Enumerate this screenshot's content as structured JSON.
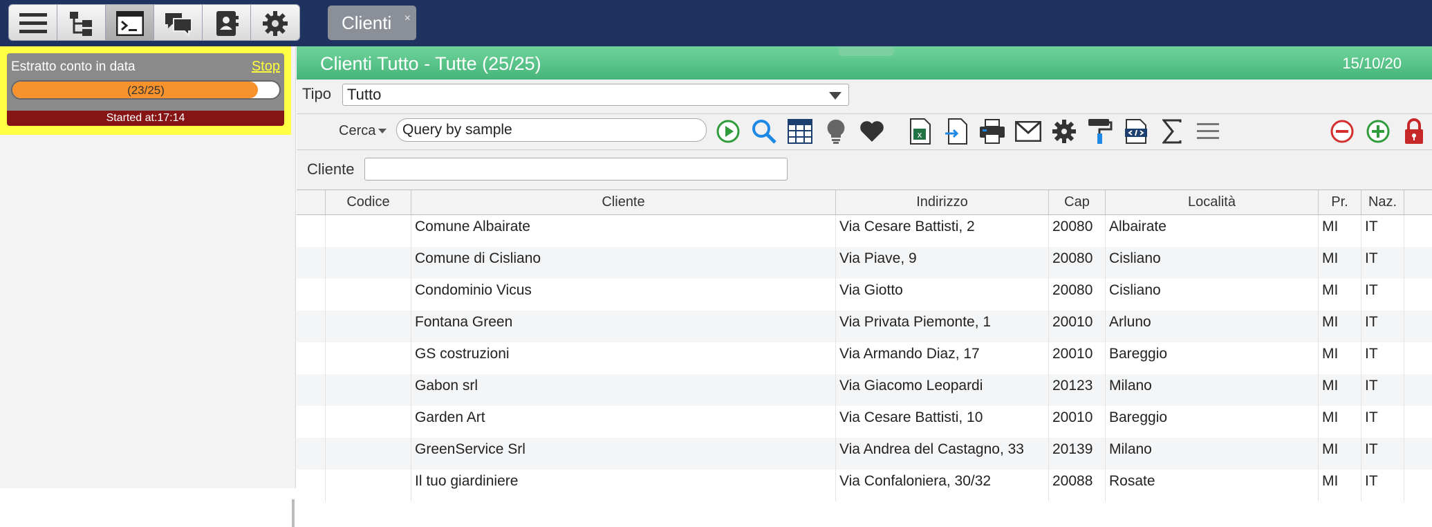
{
  "topbar": {
    "buttons": [
      {
        "icon": "menu-icon"
      },
      {
        "icon": "tree-icon"
      },
      {
        "icon": "terminal-icon"
      },
      {
        "icon": "chat-icon"
      },
      {
        "icon": "contacts-icon"
      },
      {
        "icon": "gear-icon"
      }
    ],
    "tab": {
      "label": "Clienti",
      "close": "×"
    }
  },
  "job": {
    "title": "Estratto conto in data",
    "stop_label": "Stop",
    "progress_text": "(23/25)",
    "progress_fraction": 0.92,
    "started": "Started at:17:14"
  },
  "header": {
    "title": "Clienti Tutto - Tutte (25/25)",
    "date": "15/10/20",
    "color": "#5cc88b"
  },
  "filter": {
    "tipo_label": "Tipo",
    "tipo_value": "Tutto"
  },
  "search": {
    "cerca_label": "Cerca",
    "placeholder": "Query by sample",
    "value": "Query by sample"
  },
  "cliente_filter": {
    "label": "Cliente",
    "value": ""
  },
  "table": {
    "columns": [
      "",
      "Codice",
      "Cliente",
      "Indirizzo",
      "Cap",
      "Località",
      "Pr.",
      "Naz."
    ],
    "rows": [
      [
        "",
        "",
        "Comune Albairate",
        "Via Cesare Battisti, 2",
        "20080",
        "Albairate",
        "MI",
        "IT"
      ],
      [
        "",
        "",
        "Comune di Cisliano",
        "Via Piave, 9",
        "20080",
        "Cisliano",
        "MI",
        "IT"
      ],
      [
        "",
        "",
        "Condominio Vicus",
        "Via Giotto",
        "20080",
        "Cisliano",
        "MI",
        "IT"
      ],
      [
        "",
        "",
        "Fontana Green",
        "Via Privata Piemonte, 1",
        "20010",
        "Arluno",
        "MI",
        "IT"
      ],
      [
        "",
        "",
        "GS costruzioni",
        "Via Armando Diaz, 17",
        "20010",
        "Bareggio",
        "MI",
        "IT"
      ],
      [
        "",
        "",
        "Gabon srl",
        "Via Giacomo Leopardi",
        "20123",
        "Milano",
        "MI",
        "IT"
      ],
      [
        "",
        "",
        "Garden Art",
        "Via Cesare Battisti, 10",
        "20010",
        "Bareggio",
        "MI",
        "IT"
      ],
      [
        "",
        "",
        "GreenService Srl",
        "Via Andrea del Castagno, 33",
        "20139",
        "Milano",
        "MI",
        "IT"
      ],
      [
        "",
        "",
        "Il tuo giardiniere",
        "Via Confaloniera, 30/32",
        "20088",
        "Rosate",
        "MI",
        "IT"
      ]
    ]
  }
}
